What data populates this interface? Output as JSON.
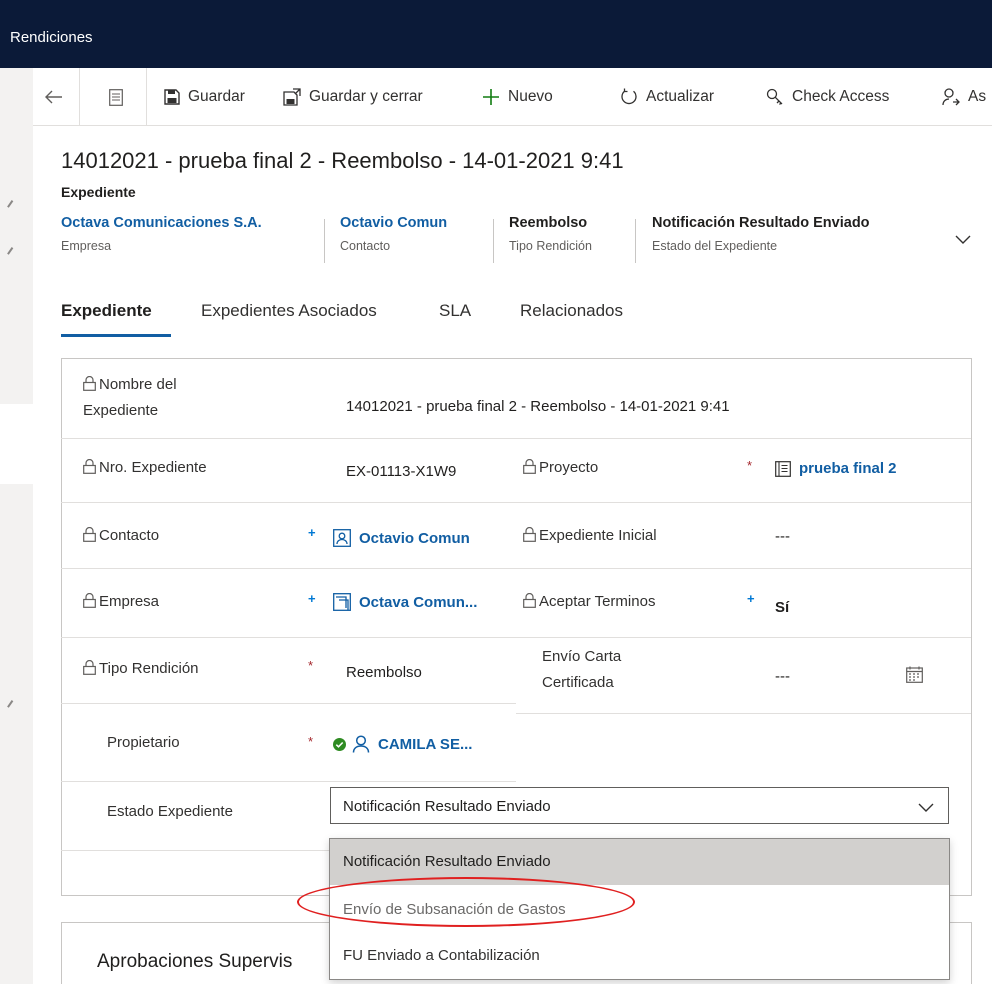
{
  "app": {
    "title": "Rendiciones"
  },
  "commands": {
    "save": "Guardar",
    "save_close": "Guardar y cerrar",
    "new": "Nuevo",
    "refresh": "Actualizar",
    "check_access": "Check Access",
    "assign_partial": "As"
  },
  "record": {
    "title": "14012021 - prueba final 2 - Reembolso - 14-01-2021 9:41",
    "entity": "Expediente",
    "header_fields": [
      {
        "value": "Octava Comunicaciones S.A.",
        "label": "Empresa"
      },
      {
        "value": "Octavio Comun",
        "label": "Contacto"
      },
      {
        "value": "Reembolso",
        "label": "Tipo Rendición"
      },
      {
        "value": "Notificación Resultado Enviado",
        "label": "Estado del Expediente"
      }
    ]
  },
  "tabs": [
    "Expediente",
    "Expedientes Asociados",
    "SLA",
    "Relacionados"
  ],
  "form": {
    "nombre": {
      "label": "Nombre del Expediente",
      "value": "14012021 - prueba final 2 - Reembolso - 14-01-2021 9:41"
    },
    "nro": {
      "label": "Nro. Expediente",
      "value": "EX-01113-X1W9"
    },
    "proyecto": {
      "label": "Proyecto",
      "value": "prueba final 2",
      "marker": "*"
    },
    "contacto": {
      "label": "Contacto",
      "value": "Octavio Comun",
      "marker": "+"
    },
    "expediente_inicial": {
      "label": "Expediente Inicial",
      "value": "---"
    },
    "empresa": {
      "label": "Empresa",
      "value": "Octava Comun...",
      "marker": "+"
    },
    "aceptar_terminos": {
      "label": "Aceptar Terminos",
      "value": "Sí",
      "marker": "+"
    },
    "tipo_rendicion": {
      "label": "Tipo Rendición",
      "value": "Reembolso",
      "marker": "*"
    },
    "envio_carta": {
      "label": "Envío Carta Certificada",
      "value": "---"
    },
    "propietario": {
      "label": "Propietario",
      "value": "CAMILA SE...",
      "marker": "*"
    },
    "estado": {
      "label": "Estado Expediente",
      "value": "Notificación Resultado Enviado"
    }
  },
  "dropdown": {
    "options": [
      "Notificación Resultado Enviado",
      "Envío de Subsanación de Gastos",
      "FU Enviado a Contabilización"
    ]
  },
  "section2": {
    "title_partial": "Aprobaciones Supervis"
  },
  "colors": {
    "topbar": "#0b1a38",
    "link": "#115ea3",
    "required": "#a4262c",
    "annotation": "#e02020",
    "presence": "#2e8b22"
  }
}
